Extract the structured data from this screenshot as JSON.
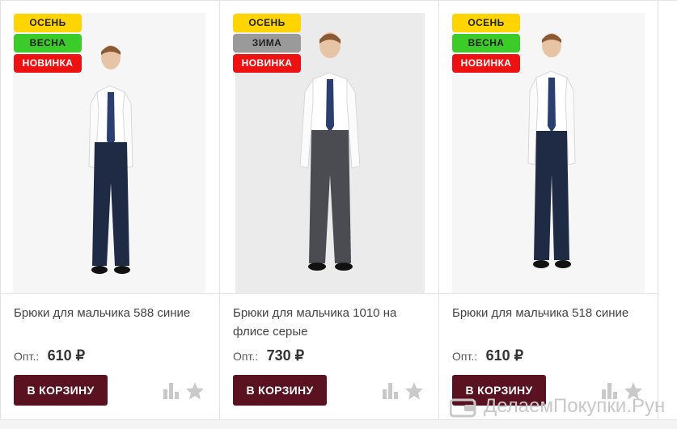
{
  "products": [
    {
      "badges": [
        {
          "label": "ОСЕНЬ",
          "color": "#ffd400"
        },
        {
          "label": "ВЕСНА",
          "color": "#3ccc2a"
        },
        {
          "label": "НОВИНКА",
          "color": "#ee1111"
        }
      ],
      "title": "Брюки для мальчика 588 синие",
      "price_label": "Опт.:",
      "price": "610 ₽",
      "cart_label": "В КОРЗИНУ",
      "pants_color": "#1f2a44"
    },
    {
      "badges": [
        {
          "label": "ОСЕНЬ",
          "color": "#ffd400"
        },
        {
          "label": "ЗИМА",
          "color": "#9a9a9a"
        },
        {
          "label": "НОВИНКА",
          "color": "#ee1111"
        }
      ],
      "title": "Брюки для мальчика 1010 на флисе серые",
      "price_label": "Опт.:",
      "price": "730 ₽",
      "cart_label": "В КОРЗИНУ",
      "pants_color": "#4a4c52"
    },
    {
      "badges": [
        {
          "label": "ОСЕНЬ",
          "color": "#ffd400"
        },
        {
          "label": "ВЕСНА",
          "color": "#3ccc2a"
        },
        {
          "label": "НОВИНКА",
          "color": "#ee1111"
        }
      ],
      "title": "Брюки для мальчика 518 синие",
      "price_label": "Опт.:",
      "price": "610 ₽",
      "cart_label": "В КОРЗИНУ",
      "pants_color": "#1f2a44"
    }
  ],
  "icons": {
    "compare": "bar-chart-icon",
    "favorite": "star-icon"
  },
  "colors": {
    "cart_button": "#5a1220",
    "icon_gray": "#c9c9c9"
  },
  "watermark": {
    "text": "ДелаемПокупки.Рун"
  }
}
